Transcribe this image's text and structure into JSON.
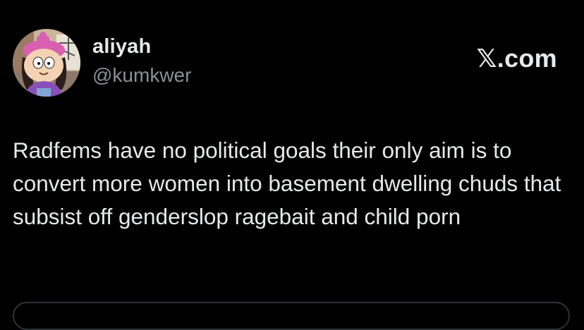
{
  "user": {
    "display_name": "aliyah",
    "handle": "@kumkwer",
    "avatar_icon": "cartoon-avatar-icon"
  },
  "brand": {
    "label": "𝕏.com",
    "icon": "x-logo-icon"
  },
  "tweet": {
    "text": "Radfems have no political goals their only aim is to convert more women into basement dwelling chuds that subsist off genderslop ragebait and child porn"
  },
  "colors": {
    "background": "#000000",
    "primary_text": "#e7e9ea",
    "secondary_text": "#8b9096",
    "border": "#2f3336"
  }
}
